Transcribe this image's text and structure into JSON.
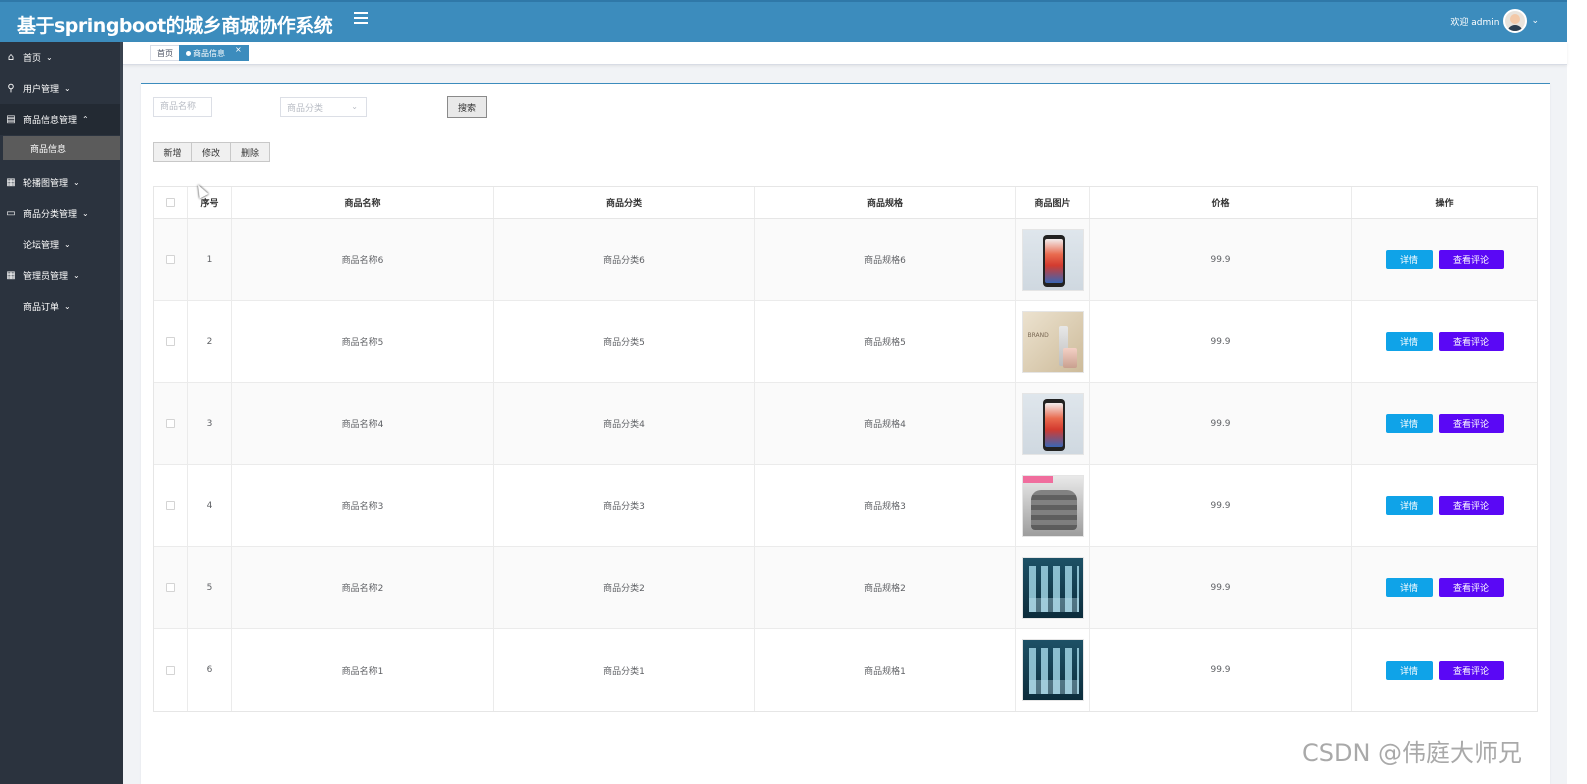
{
  "header": {
    "app_title": "基于springboot的城乡商城协作系统",
    "greeting": "欢迎 admin",
    "menu_icon": "hamburger-icon",
    "user_chevron": "⌄"
  },
  "sidebar": {
    "items": [
      {
        "label": "首页",
        "icon": "home-icon",
        "glyph": "⌂",
        "chevron": "⌄"
      },
      {
        "label": "用户管理",
        "icon": "badge-icon",
        "glyph": "⚲",
        "chevron": "⌄"
      },
      {
        "label": "商品信息管理",
        "icon": "book-icon",
        "glyph": "▤",
        "chevron": "⌃"
      },
      {
        "label": "商品信息",
        "icon": "",
        "glyph": ""
      },
      {
        "label": "轮播图管理",
        "icon": "calculator-icon",
        "glyph": "▦",
        "chevron": "⌄"
      },
      {
        "label": "商品分类管理",
        "icon": "drive-icon",
        "glyph": "▭",
        "chevron": "⌄"
      },
      {
        "label": "论坛管理",
        "icon": "",
        "glyph": "",
        "chevron": "⌄"
      },
      {
        "label": "管理员管理",
        "icon": "grid-icon",
        "glyph": "▦",
        "chevron": "⌄"
      },
      {
        "label": "商品订单",
        "icon": "",
        "glyph": "",
        "chevron": "⌄"
      }
    ]
  },
  "tags": {
    "home": "首页",
    "active": "商品信息",
    "close": "×"
  },
  "search": {
    "name_placeholder": "商品名称",
    "category_placeholder": "商品分类",
    "button": "搜索"
  },
  "actions": {
    "add": "新增",
    "edit": "修改",
    "delete": "删除"
  },
  "table": {
    "columns": [
      "序号",
      "商品名称",
      "商品分类",
      "商品规格",
      "商品图片",
      "价格",
      "操作"
    ],
    "detail_label": "详情",
    "comments_label": "查看评论",
    "rows": [
      {
        "index": "1",
        "name": "商品名称6",
        "category": "商品分类6",
        "spec": "商品规格6",
        "image": "phone-product-image",
        "price": "99.9"
      },
      {
        "index": "2",
        "name": "商品名称5",
        "category": "商品分类5",
        "spec": "商品规格5",
        "image": "cosmetic-product-image",
        "price": "99.9",
        "image_text": "BRAND"
      },
      {
        "index": "3",
        "name": "商品名称4",
        "category": "商品分类4",
        "spec": "商品规格4",
        "image": "phone-product-image",
        "price": "99.9"
      },
      {
        "index": "4",
        "name": "商品名称3",
        "category": "商品分类3",
        "spec": "商品规格3",
        "image": "cushion-product-image",
        "price": "99.9"
      },
      {
        "index": "5",
        "name": "商品名称2",
        "category": "商品分类2",
        "spec": "商品规格2",
        "image": "serum-product-image",
        "price": "99.9"
      },
      {
        "index": "6",
        "name": "商品名称1",
        "category": "商品分类1",
        "spec": "商品规格1",
        "image": "serum-product-image",
        "price": "99.9"
      }
    ]
  },
  "watermark": "CSDN @伟庭大师兄",
  "colors": {
    "header": "#3c8cbd",
    "sidebar": "#2b333e",
    "detail_button": "#0fa3e8",
    "comments_button": "#5a08f5"
  }
}
